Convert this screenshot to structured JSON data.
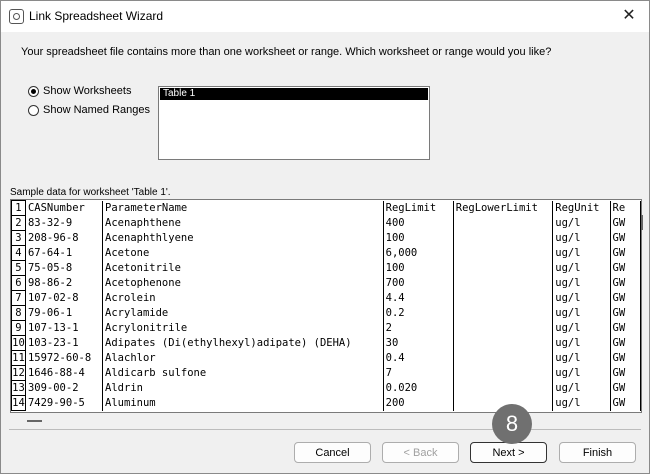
{
  "window": {
    "title": "Link Spreadsheet Wizard",
    "close_glyph": "✕"
  },
  "prompt": "Your spreadsheet file contains more than one worksheet or range. Which worksheet or range would you like?",
  "options": {
    "show_worksheets": "Show Worksheets",
    "show_named_ranges": "Show Named Ranges",
    "selected": "show_worksheets"
  },
  "list": {
    "items": [
      "Table 1"
    ],
    "selected_index": 0
  },
  "sample_label": "Sample data for worksheet 'Table 1'.",
  "grid": {
    "columns": [
      "CASNumber",
      "ParameterName",
      "RegLimit",
      "RegLowerLimit",
      "RegUnit",
      "Re"
    ],
    "rows": [
      [
        "83-32-9",
        "Acenaphthene",
        "400",
        "",
        "ug/l",
        "GW"
      ],
      [
        "208-96-8",
        "Acenaphthlyene",
        "100",
        "",
        "ug/l",
        "GW"
      ],
      [
        "67-64-1",
        "Acetone",
        "6,000",
        "",
        "ug/l",
        "GW"
      ],
      [
        "75-05-8",
        "Acetonitrile",
        "100",
        "",
        "ug/l",
        "GW"
      ],
      [
        "98-86-2",
        "Acetophenone",
        "700",
        "",
        "ug/l",
        "GW"
      ],
      [
        "107-02-8",
        "Acrolein",
        "4.4",
        "",
        "ug/l",
        "GW"
      ],
      [
        "79-06-1",
        "Acrylamide",
        "0.2",
        "",
        "ug/l",
        "GW"
      ],
      [
        "107-13-1",
        "Acrylonitrile",
        "2",
        "",
        "ug/l",
        "GW"
      ],
      [
        "103-23-1",
        "Adipates (Di(ethylhexyl)adipate) (DEHA)",
        "30",
        "",
        "ug/l",
        "GW"
      ],
      [
        "15972-60-8",
        "Alachlor",
        "0.4",
        "",
        "ug/l",
        "GW"
      ],
      [
        "1646-88-4",
        "Aldicarb sulfone",
        "7",
        "",
        "ug/l",
        "GW"
      ],
      [
        "309-00-2",
        "Aldrin",
        "0.020",
        "",
        "ug/l",
        "GW"
      ],
      [
        "7429-90-5",
        "Aluminum",
        "200",
        "",
        "ug/l",
        "GW"
      ]
    ]
  },
  "buttons": {
    "cancel": "Cancel",
    "back": "< Back",
    "next": "Next >",
    "finish": "Finish"
  },
  "badge": "8"
}
